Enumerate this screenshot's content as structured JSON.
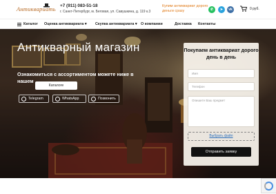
{
  "header": {
    "logo_text": "Антиквариать",
    "phone": "+7 (911) 083-51-18",
    "address": "г. Санкт-Петербург, м. Беговая, ул. Савушкина, д. 119 к.3",
    "promo": "Купим антиквариат дорого деньги сразу",
    "social": [
      {
        "name": "whatsapp",
        "glyph": "✆",
        "color": "#25c05f"
      },
      {
        "name": "telegram",
        "glyph": "➤",
        "color": "#2aa3dd"
      },
      {
        "name": "vk",
        "glyph": "vk",
        "color": "#3d6fa6"
      }
    ],
    "cart_price": "0 руб."
  },
  "nav": {
    "items": [
      {
        "label": "Каталог"
      },
      {
        "label": "Оценка антиквариата ▾"
      },
      {
        "label": "Скупка антиквариата ▾"
      },
      {
        "label": "О компании"
      },
      {
        "label": "Доставка"
      },
      {
        "label": "Контакты"
      }
    ]
  },
  "hero": {
    "title": "Антикварный магазин",
    "subtitle": "Ознакомиться с ассортиментом можете ниже в нашем",
    "catalog_button": "Каталоге",
    "chips": [
      {
        "label": "Telegram"
      },
      {
        "label": "WhatsApp"
      },
      {
        "label": "Позвонить"
      }
    ]
  },
  "form": {
    "title": "Покупаем антиквариат дорого день в день",
    "name_placeholder": "Имя",
    "phone_placeholder": "Телефон",
    "message_placeholder": "Опишите Ваш предмет",
    "file_label": "Выбрать файл",
    "submit_label": "Отправить заявку"
  },
  "colors": {
    "accent": "#e07b1a",
    "logo": "#b5651d",
    "button_dark": "#111111"
  }
}
